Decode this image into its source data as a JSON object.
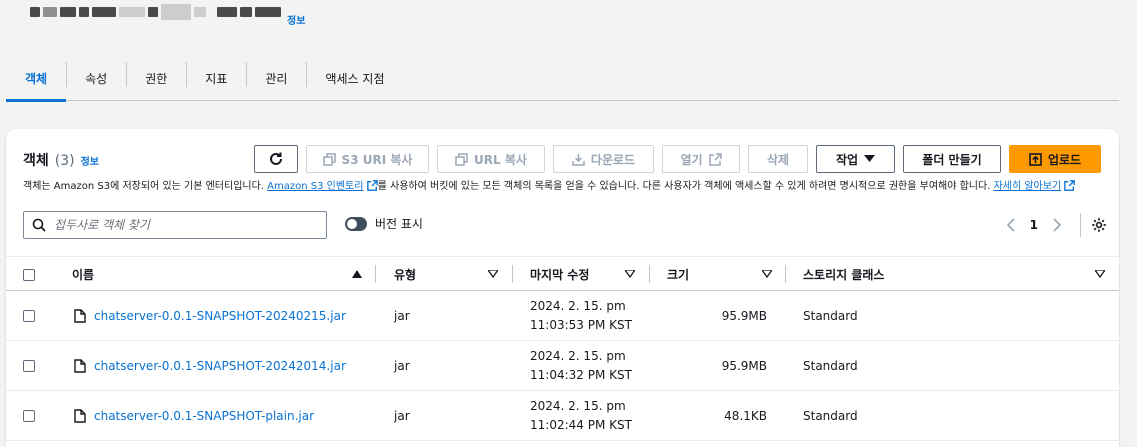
{
  "header": {
    "info_label": "정보"
  },
  "tabs": [
    {
      "label": "객체",
      "active": true
    },
    {
      "label": "속성"
    },
    {
      "label": "권한"
    },
    {
      "label": "지표"
    },
    {
      "label": "관리"
    },
    {
      "label": "액세스 지점"
    }
  ],
  "panel": {
    "title": "객체",
    "count": "(3)",
    "info_label": "정보",
    "toolbar": {
      "copy_s3_uri": "S3 URI 복사",
      "copy_url": "URL 복사",
      "download": "다운로드",
      "open": "열기",
      "delete": "삭제",
      "actions": "작업",
      "create_folder": "폴더 만들기",
      "upload": "업로드"
    },
    "description": {
      "part1": "객체는 Amazon S3에 저장되어 있는 기본 엔터티입니다. ",
      "link1": "Amazon S3 인벤토리",
      "part2": "를 사용하여 버킷에 있는 모든 객체의 목록을 얻을 수 있습니다. 다른 사용자가 객체에 액세스할 수 있게 하려면 명시적으로 권한을 부여해야 합니다. ",
      "link2": "자세히 알아보기"
    },
    "search": {
      "placeholder": "접두사로 객체 찾기",
      "value": ""
    },
    "show_versions_label": "버전 표시",
    "page": "1"
  },
  "table": {
    "columns": [
      "이름",
      "유형",
      "마지막 수정",
      "크기",
      "스토리지 클래스"
    ],
    "rows": [
      {
        "name": "chatserver-0.0.1-SNAPSHOT-20240215.jar",
        "type": "jar",
        "modified_date": "2024. 2. 15. pm",
        "modified_time": "11:03:53 PM KST",
        "size": "95.9MB",
        "storage_class": "Standard"
      },
      {
        "name": "chatserver-0.0.1-SNAPSHOT-20242014.jar",
        "type": "jar",
        "modified_date": "2024. 2. 15. pm",
        "modified_time": "11:04:32 PM KST",
        "size": "95.9MB",
        "storage_class": "Standard"
      },
      {
        "name": "chatserver-0.0.1-SNAPSHOT-plain.jar",
        "type": "jar",
        "modified_date": "2024. 2. 15. pm",
        "modified_time": "11:02:44 PM KST",
        "size": "48.1KB",
        "storage_class": "Standard"
      }
    ]
  },
  "colors": {
    "link": "#0972d3",
    "primary": "#ff9900",
    "text": "#16191f",
    "disabled": "#9ba7b6"
  }
}
